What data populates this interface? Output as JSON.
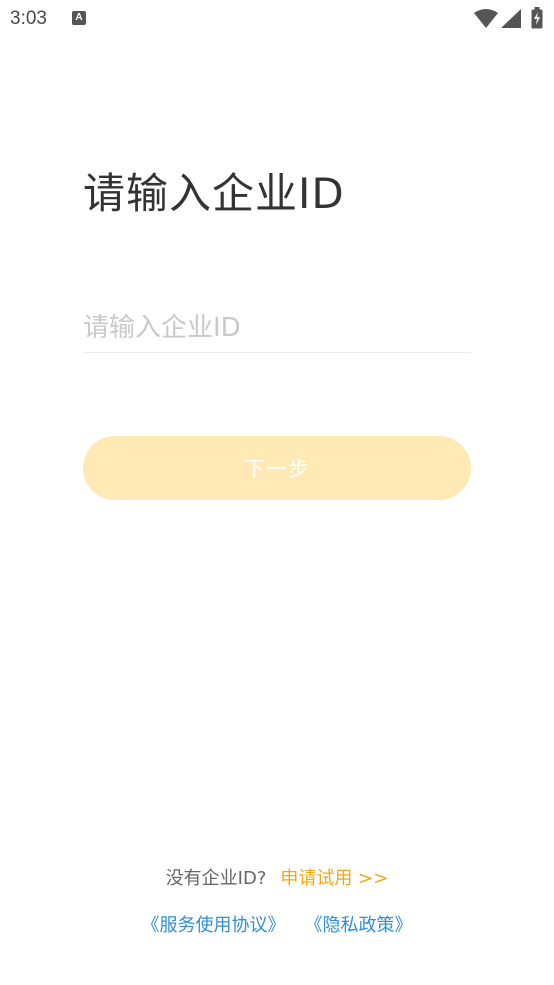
{
  "status_bar": {
    "time": "3:03",
    "notification_icon_letter": "A",
    "icons": [
      "wifi-icon",
      "cellular-signal-icon",
      "battery-charging-icon"
    ]
  },
  "login": {
    "title": "请输入企业ID",
    "input_value": "",
    "input_placeholder": "请输入企业ID",
    "next_button_label": "下一步"
  },
  "footer": {
    "no_id_text": "没有企业ID?",
    "apply_trial_link": "申请试用 >>",
    "service_agreement_link": "《服务使用协议》",
    "privacy_policy_link": "《隐私政策》"
  },
  "colors": {
    "accent": "#f5a70f",
    "button_disabled_bg": "#ffe9b4",
    "link_blue": "#2f8fd8",
    "title_text": "#333333",
    "placeholder": "#c9c9c9"
  }
}
